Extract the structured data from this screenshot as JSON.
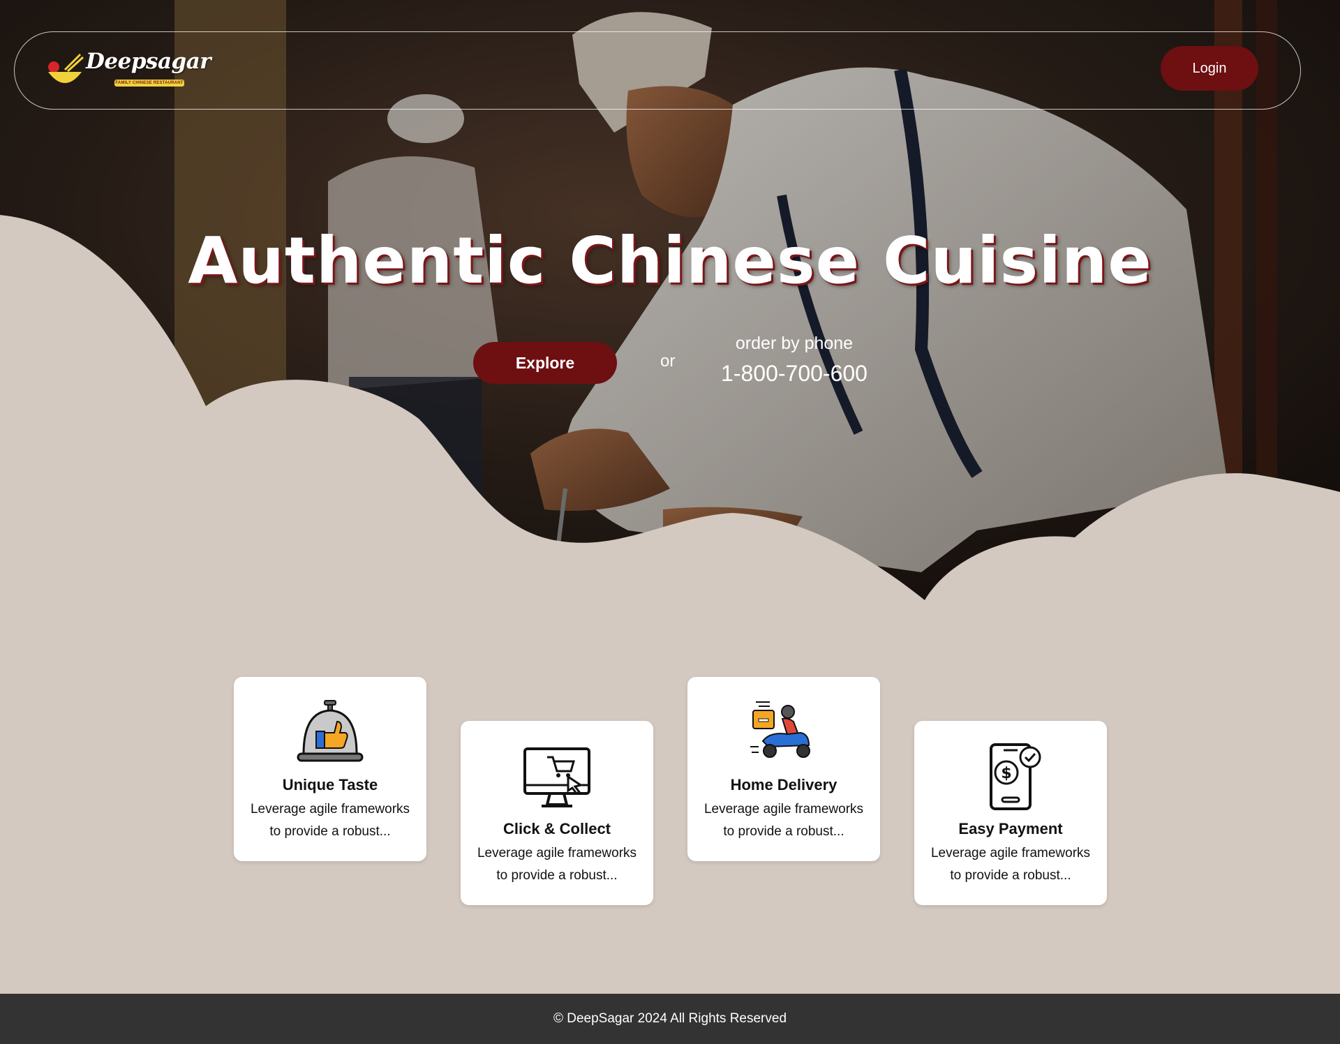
{
  "brand": {
    "name": "Deepsagar",
    "tagline": "FAMILY CHINESE RESTAURANT"
  },
  "nav": {
    "login_label": "Login"
  },
  "hero": {
    "title": "Authentic Chinese Cuisine",
    "explore_label": "Explore",
    "or_text": "or",
    "phone_label": "order by phone",
    "phone_number": "1-800-700-600"
  },
  "features": [
    {
      "title": "Unique Taste",
      "description": "Leverage agile frameworks to provide a robust...",
      "icon": "cloche-thumbs-up-icon"
    },
    {
      "title": "Click & Collect",
      "description": "Leverage agile frameworks to provide a robust...",
      "icon": "computer-cart-icon"
    },
    {
      "title": "Home Delivery",
      "description": "Leverage agile frameworks to provide a robust...",
      "icon": "delivery-scooter-icon"
    },
    {
      "title": "Easy Payment",
      "description": "Leverage agile frameworks to provide a robust...",
      "icon": "phone-payment-icon"
    }
  ],
  "footer": {
    "copyright": "© DeepSagar 2024 All Rights Reserved"
  },
  "colors": {
    "accent": "#6e0f12",
    "page_background": "#d4c9c0",
    "footer_background": "#333333"
  }
}
